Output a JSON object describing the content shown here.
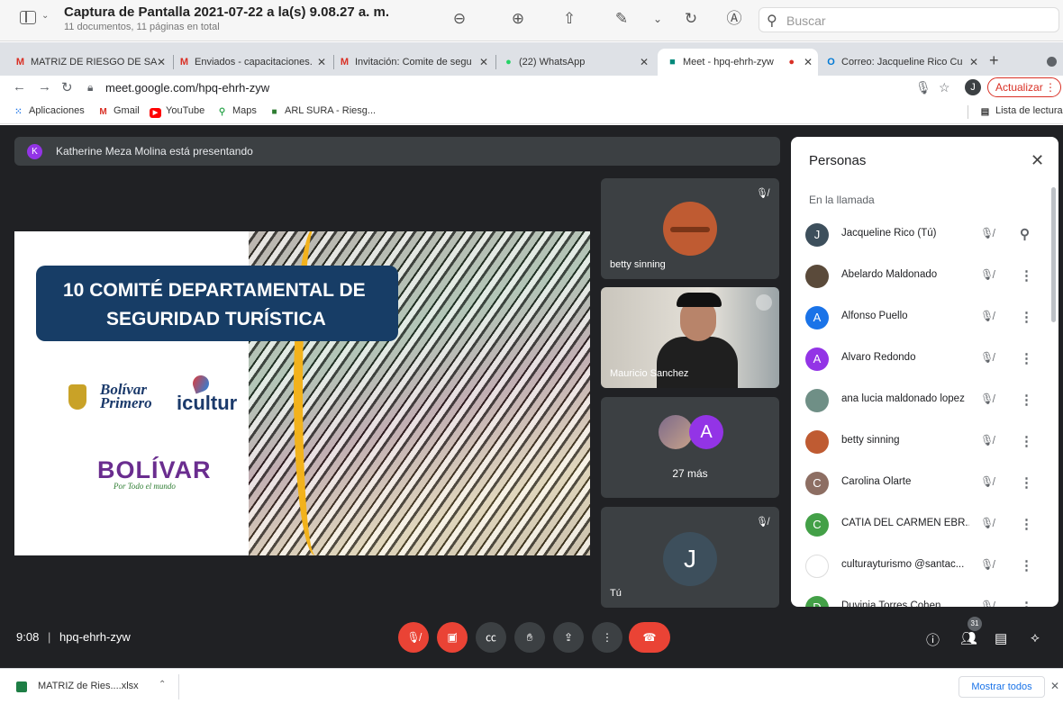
{
  "preview": {
    "title": "Captura de Pantalla 2021-07-22 a la(s) 9.08.27 a. m.",
    "subtitle": "11 documentos, 11 páginas en total",
    "search_placeholder": "Buscar"
  },
  "browser": {
    "tabs": [
      {
        "label": "MATRIZ DE RIESGO DE SA",
        "favicon": "gmail-icon",
        "favicon_glyph": "M",
        "color": "#d93025"
      },
      {
        "label": "Enviados - capacitaciones.",
        "favicon": "gmail-icon",
        "favicon_glyph": "M",
        "color": "#d93025"
      },
      {
        "label": "Invitación: Comite de segu",
        "favicon": "gmail-icon",
        "favicon_glyph": "M",
        "color": "#d93025"
      },
      {
        "label": "(22) WhatsApp",
        "favicon": "whatsapp-icon",
        "favicon_glyph": "●",
        "color": "#25d366"
      },
      {
        "label": "Meet - hpq-ehrh-zyw",
        "favicon": "meet-icon",
        "favicon_glyph": "■",
        "color": "#00897b",
        "active": true
      },
      {
        "label": "Correo: Jacqueline Rico Cu",
        "favicon": "outlook-icon",
        "favicon_glyph": "O",
        "color": "#0078d4"
      }
    ],
    "url": "meet.google.com/hpq-ehrh-zyw",
    "profile_initial": "J",
    "update_label": "Actualizar",
    "bookmarks": [
      {
        "label": "Aplicaciones",
        "icon": "apps-grid-icon",
        "glyph": "⋮⋮",
        "color": "#1a73e8"
      },
      {
        "label": "Gmail",
        "icon": "gmail-icon",
        "glyph": "M",
        "color": "#d93025"
      },
      {
        "label": "YouTube",
        "icon": "youtube-icon",
        "glyph": "▶",
        "color": "#ff0000"
      },
      {
        "label": "Maps",
        "icon": "maps-pin-icon",
        "glyph": "⚲",
        "color": "#34a853"
      },
      {
        "label": "ARL SURA - Riesg...",
        "icon": "sura-icon",
        "glyph": "■",
        "color": "#2e7d32"
      }
    ],
    "reading_list": "Lista de lectura"
  },
  "meet": {
    "presenter_initial": "K",
    "presenting_text": "Katherine Meza Molina está presentando",
    "slide": {
      "title_line1": "10 COMITÉ DEPARTAMENTAL DE",
      "title_line2": "SEGURIDAD TURÍSTICA",
      "logo_bolivar_primero_1": "Bolívar",
      "logo_bolivar_primero_2": "Primero",
      "logo_icultur": "icultur",
      "logo_bolivar": "BOLÍVAR",
      "logo_bolivar_tagline": "Por Todo el mundo"
    },
    "tiles": {
      "betty": "betty sinning",
      "mauricio": "Mauricio Sanchez",
      "more_initial": "A",
      "more_count": "27 más",
      "you_initial": "J",
      "you_label": "Tú"
    },
    "people_panel": {
      "title": "Personas",
      "section": "En la llamada",
      "people": [
        {
          "name": "Jacqueline Rico (Tú)",
          "initial": "J",
          "color": "#3d4f5c",
          "action": "pin-icon"
        },
        {
          "name": "Abelardo Maldonado",
          "initial": "",
          "color": "#5a4a3a",
          "action": "more-icon"
        },
        {
          "name": "Alfonso Puello",
          "initial": "A",
          "color": "#1a73e8",
          "action": "more-icon"
        },
        {
          "name": "Alvaro Redondo",
          "initial": "A",
          "color": "#9334e6",
          "action": "more-icon"
        },
        {
          "name": "ana lucia maldonado lopez",
          "initial": "",
          "color": "#6f8f86",
          "action": "more-icon"
        },
        {
          "name": "betty sinning",
          "initial": "",
          "color": "#bf5b32",
          "action": "more-icon"
        },
        {
          "name": "Carolina Olarte",
          "initial": "C",
          "color": "#8d6e63",
          "action": "more-icon"
        },
        {
          "name": "CATIA DEL CARMEN EBR...",
          "initial": "C",
          "color": "#43a047",
          "action": "more-icon"
        },
        {
          "name": "culturayturismo @santac...",
          "initial": "",
          "color": "#ffffff",
          "action": "more-icon"
        },
        {
          "name": "Duvinia Torres Cohen",
          "initial": "D",
          "color": "#43a047",
          "action": "more-icon"
        }
      ]
    },
    "bottom": {
      "time": "9:08",
      "separator": "|",
      "meeting_code": "hpq-ehrh-zyw",
      "participant_count": "31"
    }
  },
  "downloads": {
    "file": "MATRIZ de Ries....xlsx",
    "show_all": "Mostrar todos"
  }
}
